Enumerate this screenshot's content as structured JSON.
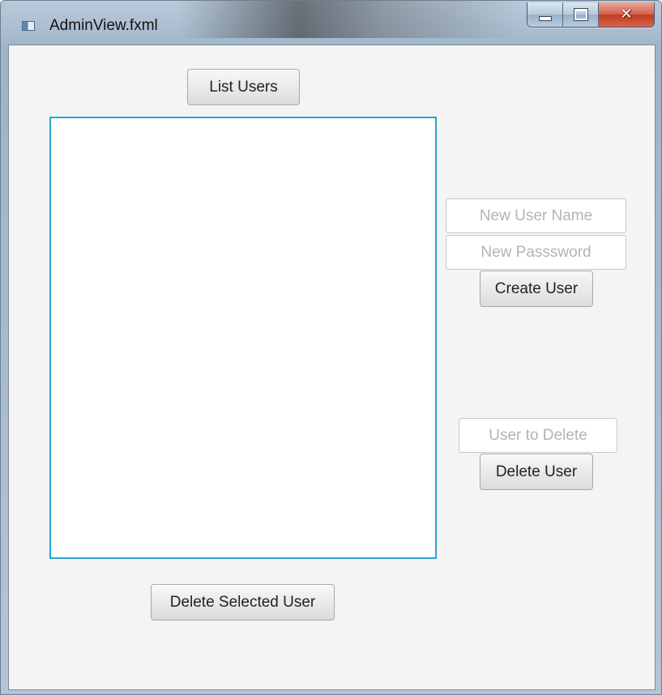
{
  "window": {
    "title": "AdminView.fxml"
  },
  "buttons": {
    "list_users": "List Users",
    "create_user": "Create User",
    "delete_user": "Delete User",
    "delete_selected_user": "Delete Selected User"
  },
  "fields": {
    "new_user_name": {
      "value": "",
      "placeholder": "New User Name"
    },
    "new_password": {
      "value": "",
      "placeholder": "New Passsword"
    },
    "user_to_delete": {
      "value": "",
      "placeholder": "User to Delete"
    }
  },
  "user_list": {
    "items": []
  },
  "icons": {
    "app": "app-window-icon",
    "minimize": "minimize-icon",
    "maximize": "maximize-icon",
    "close": "close-icon"
  },
  "colors": {
    "list_focus_border": "#29a3d4",
    "client_background": "#f4f4f4",
    "close_button": "#c13a20"
  }
}
